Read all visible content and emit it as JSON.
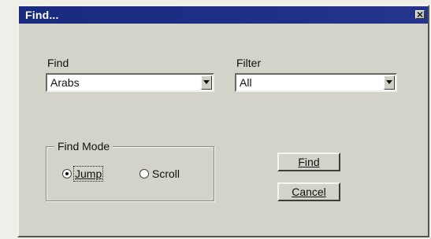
{
  "window": {
    "title": "Find..."
  },
  "find": {
    "label": "Find",
    "value": "Arabs"
  },
  "filter": {
    "label": "Filter",
    "value": "All"
  },
  "find_mode": {
    "label": "Find Mode",
    "options": [
      {
        "label": "Jump",
        "selected": true
      },
      {
        "label": "Scroll",
        "selected": false
      }
    ]
  },
  "buttons": {
    "find": "Find",
    "cancel": "Cancel"
  },
  "icons": {
    "close": "close-icon",
    "dropdown": "chevron-down-icon"
  }
}
